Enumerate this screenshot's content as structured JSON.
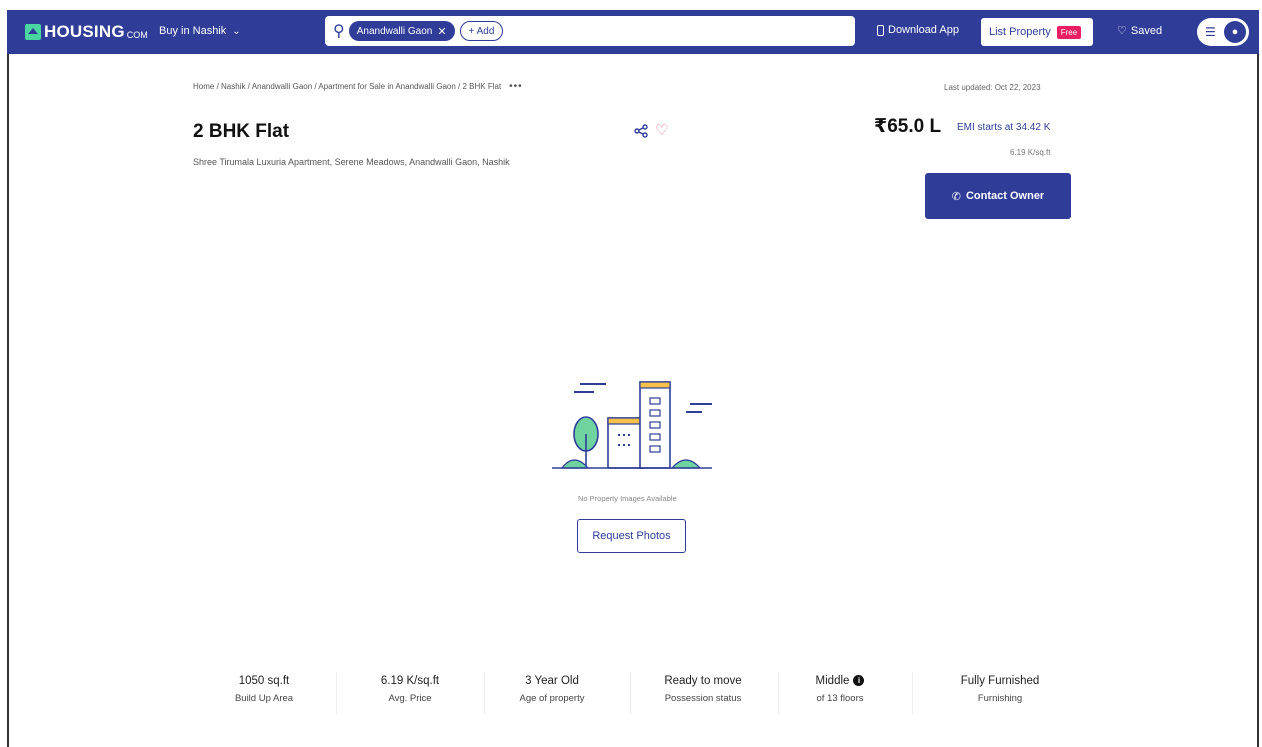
{
  "navbar": {
    "logo_text": "HOUSING",
    "logo_suffix": "COM",
    "buy_in": "Buy in Nashik",
    "search_chip": "Anandwalli Gaon",
    "add_label": "+ Add",
    "download_app": "Download App",
    "list_property": "List Property",
    "free_badge": "Free",
    "saved": "Saved"
  },
  "breadcrumb": "Home / Nashik / Anandwalli Gaon / Apartment for Sale in Anandwalli Gaon / 2 BHK Flat",
  "last_updated": "Last updated: Oct 22, 2023",
  "listing": {
    "title": "2 BHK Flat",
    "address": "Shree Tirumala Luxuria Apartment, Serene Meadows, Anandwalli Gaon, Nashik",
    "price": "₹65.0 L",
    "emi": "EMI starts at 34.42 K",
    "per_sqft": "6.19 K/sq.ft",
    "contact_label": "Contact Owner"
  },
  "gallery": {
    "no_images": "No Property Images Available",
    "request_label": "Request Photos"
  },
  "stats": [
    {
      "value": "1050 sq.ft",
      "label": "Build Up Area"
    },
    {
      "value": "6.19 K/sq.ft",
      "label": "Avg. Price"
    },
    {
      "value": "3 Year Old",
      "label": "Age of property"
    },
    {
      "value": "Ready to move",
      "label": "Possession status"
    },
    {
      "value": "Middle",
      "label": "of 13 floors"
    },
    {
      "value": "Fully Furnished",
      "label": "Furnishing"
    }
  ],
  "colors": {
    "brand": "#2f3d99",
    "accent_green": "#4ad6a0",
    "free_badge": "#e91e63"
  }
}
